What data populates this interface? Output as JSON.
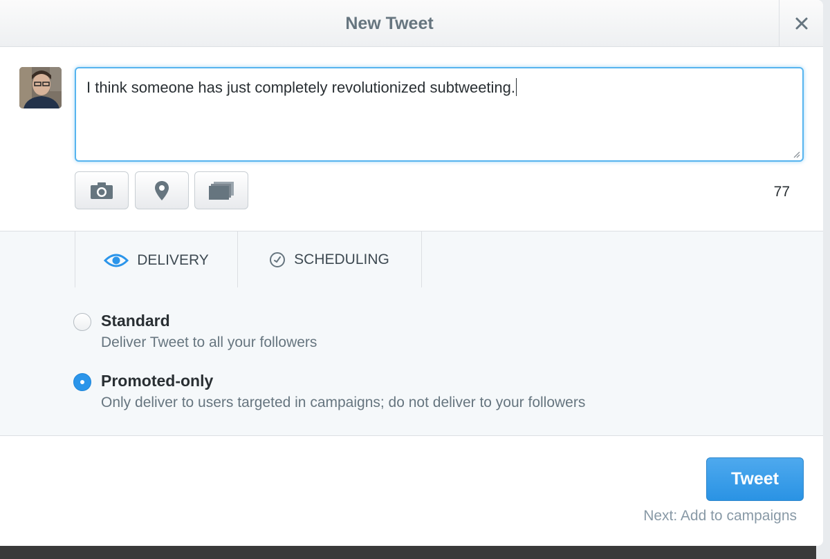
{
  "dialog": {
    "title": "New Tweet",
    "close_icon": "close-icon"
  },
  "compose": {
    "text": "I think someone has just completely revolutionized subtweeting.",
    "char_count": "77"
  },
  "toolbar": {
    "buttons": [
      {
        "icon": "camera-icon"
      },
      {
        "icon": "location-pin-icon"
      },
      {
        "icon": "cards-icon"
      }
    ]
  },
  "tabs": [
    {
      "label": "DELIVERY",
      "icon": "eye-icon",
      "active": true
    },
    {
      "label": "SCHEDULING",
      "icon": "clock-icon",
      "active": false
    }
  ],
  "delivery_options": [
    {
      "title": "Standard",
      "description": "Deliver Tweet to all your followers",
      "selected": false
    },
    {
      "title": "Promoted-only",
      "description": "Only deliver to users targeted in campaigns; do not deliver to your followers",
      "selected": true
    }
  ],
  "footer": {
    "tweet_label": "Tweet",
    "next_link": "Next: Add to campaigns"
  },
  "colors": {
    "accent": "#2b95ea",
    "focus_border": "#56b4ef",
    "muted_text": "#66757f"
  }
}
